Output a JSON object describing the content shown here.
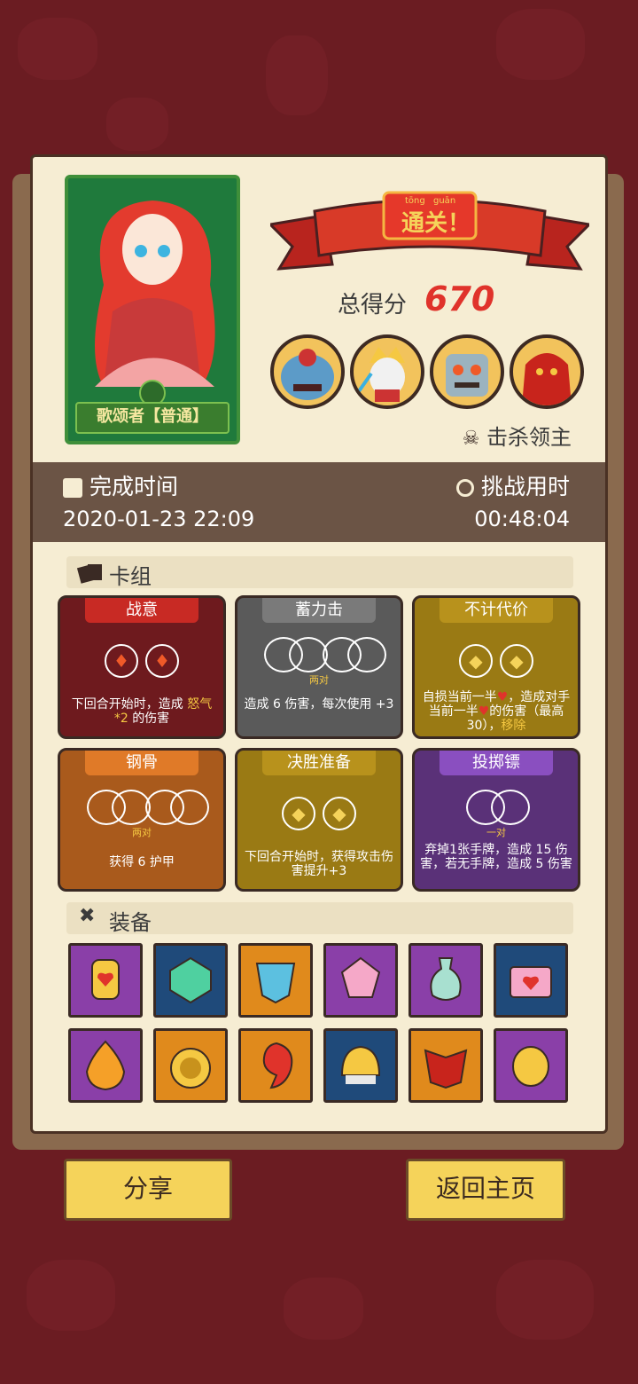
{
  "hero": {
    "name": "歌颂者【普通】"
  },
  "banner": {
    "pinyin1": "tōng",
    "pinyin2": "guān",
    "text": "通关！"
  },
  "score": {
    "label": "总得分",
    "value": "670"
  },
  "bosses": {
    "kill_label": "击杀领主",
    "portraits": [
      "boss-1",
      "boss-2",
      "boss-3",
      "boss-4"
    ]
  },
  "time": {
    "finish_label": "完成时间",
    "finish_value": "2020-01-23 22:09",
    "challenge_label": "挑战用时",
    "challenge_value": "00:48:04"
  },
  "deck": {
    "label": "卡组",
    "cards": [
      {
        "title": "战意",
        "desc1": "下回合开始时，造成",
        "desc2": "怒",
        "desc3": "气*2",
        "desc4": "的伤害"
      },
      {
        "title": "蓄力击",
        "sub": "两对",
        "desc": "造成 6 伤害，每次使用 +3"
      },
      {
        "title": "不计代价",
        "desc1": "自损当前一半",
        "desc2": "，造成对手当前一半",
        "desc3": "的",
        "desc4": "伤害（最高30），",
        "desc5": "移除"
      },
      {
        "title": "钢骨",
        "sub": "两对",
        "desc": "获得 6 护甲"
      },
      {
        "title": "决胜准备",
        "desc": "下回合开始时，获得攻击伤害提升+3"
      },
      {
        "title": "投掷镖",
        "sub": "一对",
        "desc": "弃掉1张手牌，造成 15 伤害，若无手牌，造成 5 伤害"
      }
    ]
  },
  "equipment": {
    "label": "装备"
  },
  "buttons": {
    "share": "分享",
    "home": "返回主页"
  },
  "colors": {
    "red": "#6e1a1e",
    "gray": "#5a5a5a",
    "gold": "#9a7a14",
    "orange": "#a95a1c",
    "purple": "#5a3178",
    "score": "#e0332b"
  }
}
